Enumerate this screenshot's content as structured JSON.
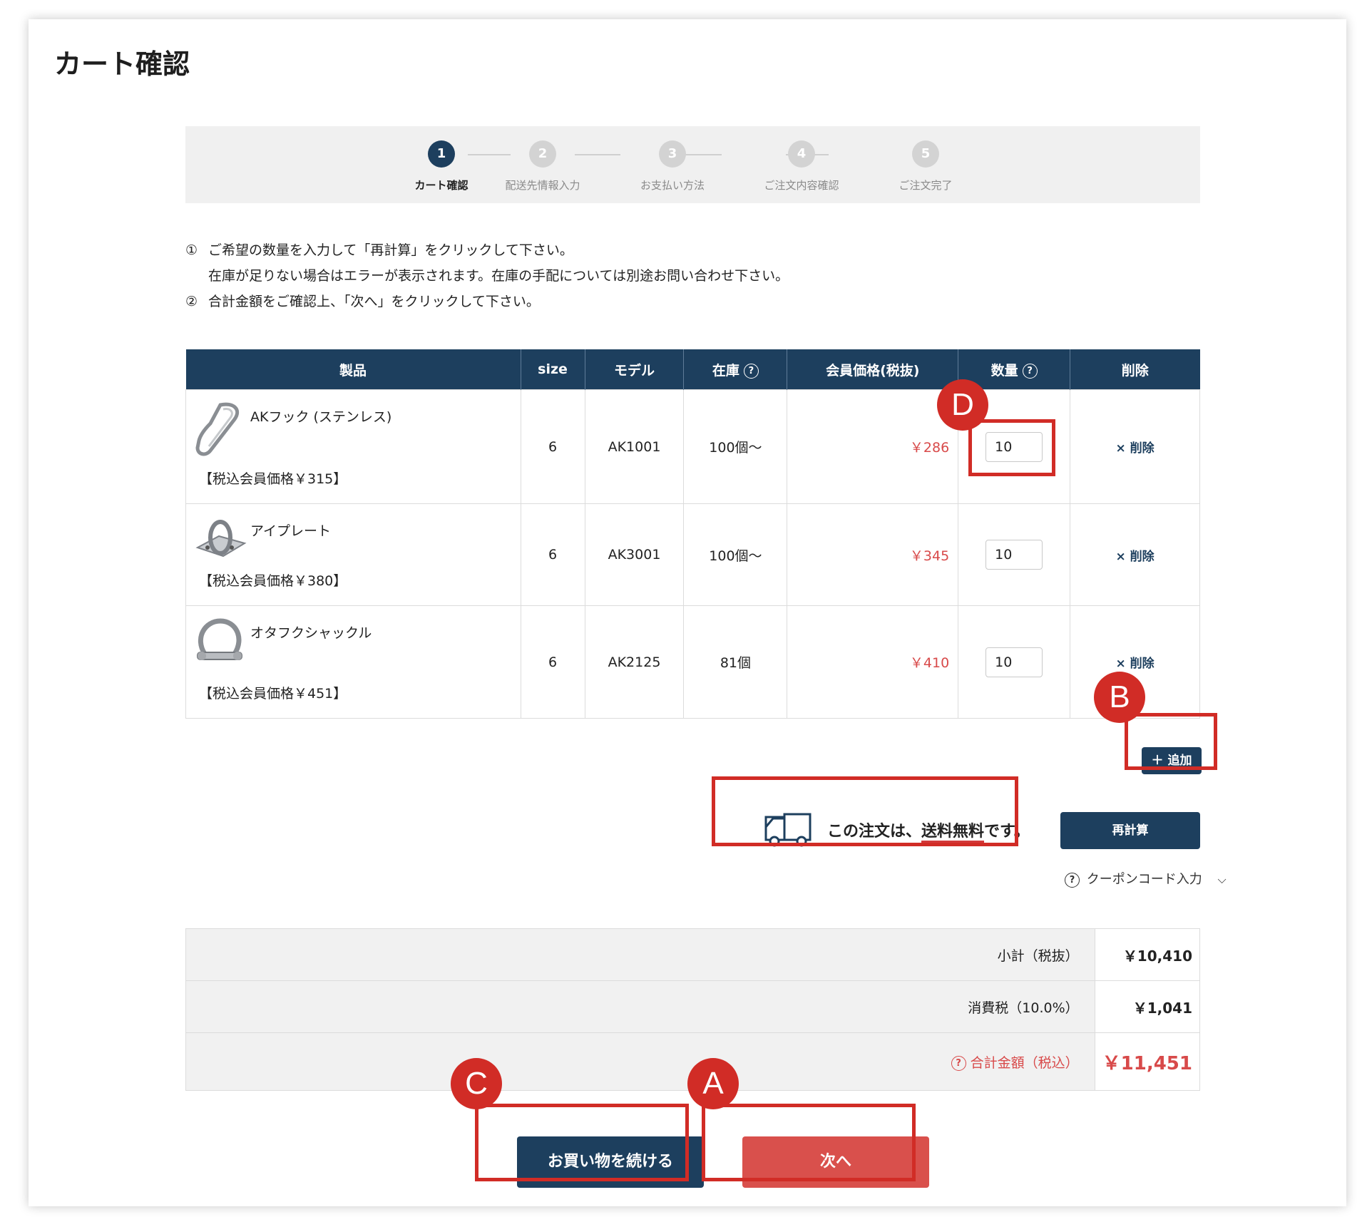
{
  "page": {
    "title": "カート確認"
  },
  "steps": [
    {
      "num": "1",
      "label": "カート確認",
      "active": true
    },
    {
      "num": "2",
      "label": "配送先情報入力",
      "active": false
    },
    {
      "num": "3",
      "label": "お支払い方法",
      "active": false
    },
    {
      "num": "4",
      "label": "ご注文内容確認",
      "active": false
    },
    {
      "num": "5",
      "label": "ご注文完了",
      "active": false
    }
  ],
  "instructions": {
    "line1_num": "①",
    "line1": "ご希望の数量を入力して「再計算」をクリックして下さい。",
    "line1b": "在庫が足りない場合はエラーが表示されます。在庫の手配については別途お問い合わせ下さい。",
    "line2_num": "②",
    "line2": "合計金額をご確認上、「次へ」をクリックして下さい。"
  },
  "table": {
    "headers": {
      "product": "製品",
      "size": "size",
      "model": "モデル",
      "stock": "在庫",
      "price": "会員価格(税抜)",
      "qty": "数量",
      "delete": "削除"
    },
    "rows": [
      {
        "name": "AKフック (ステンレス)",
        "tax_price": "【税込会員価格￥315】",
        "size": "6",
        "model": "AK1001",
        "stock": "100個〜",
        "price": "￥286",
        "qty": "10",
        "delete": "削除"
      },
      {
        "name": "アイプレート",
        "tax_price": "【税込会員価格￥380】",
        "size": "6",
        "model": "AK3001",
        "stock": "100個〜",
        "price": "￥345",
        "qty": "10",
        "delete": "削除"
      },
      {
        "name": "オタフクシャックル",
        "tax_price": "【税込会員価格￥451】",
        "size": "6",
        "model": "AK2125",
        "stock": "81個",
        "price": "￥410",
        "qty": "10",
        "delete": "削除"
      }
    ]
  },
  "actions": {
    "add": "＋ 追加",
    "recalc": "再計算",
    "coupon": "クーポンコード入力",
    "continue": "お買い物を続ける",
    "next": "次へ"
  },
  "shipping": {
    "prefix": "この注文は、",
    "emph": "送料無料",
    "suffix": "です。"
  },
  "summary": {
    "subtotal_label": "小計（税抜）",
    "subtotal": "￥10,410",
    "tax_label": "消費税（10.0%）",
    "tax": "￥1,041",
    "total_label": "合計金額（税込）",
    "total": "￥11,451"
  },
  "annotations": {
    "a": "A",
    "b": "B",
    "c": "C",
    "d": "D"
  },
  "icons": {
    "help": "?",
    "delete": "×",
    "chevron": "⌵"
  },
  "colors": {
    "navy": "#1d3f5e",
    "red": "#d84a4a",
    "annotation_red": "#d12c26"
  }
}
